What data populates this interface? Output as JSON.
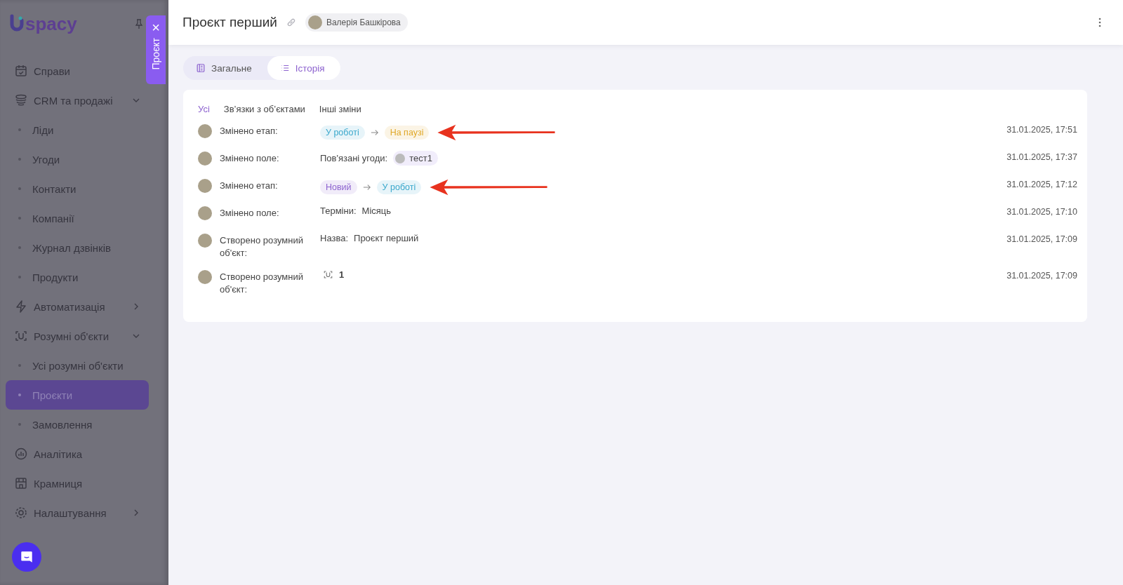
{
  "sidebar": {
    "logo": "spacy",
    "drawer_tab": {
      "label": "Проєкт",
      "close": "×"
    },
    "items": [
      {
        "label": "Справи",
        "selected": false
      },
      {
        "label": "CRM та продажі",
        "selected": false,
        "expanded": true,
        "children": [
          {
            "label": "Ліди",
            "selected": false
          },
          {
            "label": "Угоди",
            "selected": false
          },
          {
            "label": "Контакти",
            "selected": false
          },
          {
            "label": "Компанії",
            "selected": false
          },
          {
            "label": "Журнал дзвінків",
            "selected": false
          },
          {
            "label": "Продукти",
            "selected": false
          }
        ]
      },
      {
        "label": "Автоматизація",
        "selected": false,
        "expanded": false
      },
      {
        "label": "Розумні об'єкти",
        "selected": false,
        "expanded": true,
        "children": [
          {
            "label": "Усі розумні об'єкти",
            "selected": false
          },
          {
            "label": "Проєкти",
            "selected": true
          },
          {
            "label": "Замовлення",
            "selected": false
          }
        ]
      },
      {
        "label": "Аналітика",
        "selected": false
      },
      {
        "label": "Крамниця",
        "selected": false
      },
      {
        "label": "Налаштування",
        "selected": false,
        "expanded": false
      }
    ]
  },
  "header": {
    "title": "Проєкт перший",
    "owner": "Валерія Башкірова"
  },
  "tabs": [
    {
      "label": "Загальне",
      "selected": false
    },
    {
      "label": "Історія",
      "selected": true
    }
  ],
  "filters": [
    {
      "label": "Усі",
      "selected": true
    },
    {
      "label": "Зв’язки з об’єктами",
      "selected": false
    },
    {
      "label": "Інші зміни",
      "selected": false
    }
  ],
  "history": [
    {
      "kind": "stage",
      "action": "Змінено етап:",
      "from": {
        "label": "У роботі",
        "color": "#3aa8cc"
      },
      "to": {
        "label": "На паузі",
        "color": "#e0a829"
      },
      "time": "31.01.2025, 17:51",
      "highlighted": true
    },
    {
      "kind": "link",
      "action": "Змінено поле:",
      "field": "Пов'язані угоди:",
      "value": "тест1",
      "time": "31.01.2025, 17:37",
      "highlighted": false
    },
    {
      "kind": "stage",
      "action": "Змінено етап:",
      "from": {
        "label": "Новий",
        "color": "#8d63cf"
      },
      "to": {
        "label": "У роботі",
        "color": "#3aa8cc"
      },
      "time": "31.01.2025, 17:12",
      "highlighted": true
    },
    {
      "kind": "text",
      "action": "Змінено поле:",
      "field": "Терміни:",
      "value": "Місяць",
      "time": "31.01.2025, 17:10",
      "highlighted": false
    },
    {
      "kind": "text",
      "action": "Створено розумний об'єкт:",
      "field": "Назва:",
      "value": "Проєкт перший",
      "time": "31.01.2025, 17:09",
      "highlighted": false
    },
    {
      "kind": "object",
      "action": "Створено розумний об'єкт:",
      "value": "1",
      "time": "31.01.2025, 17:09",
      "highlighted": false
    }
  ]
}
